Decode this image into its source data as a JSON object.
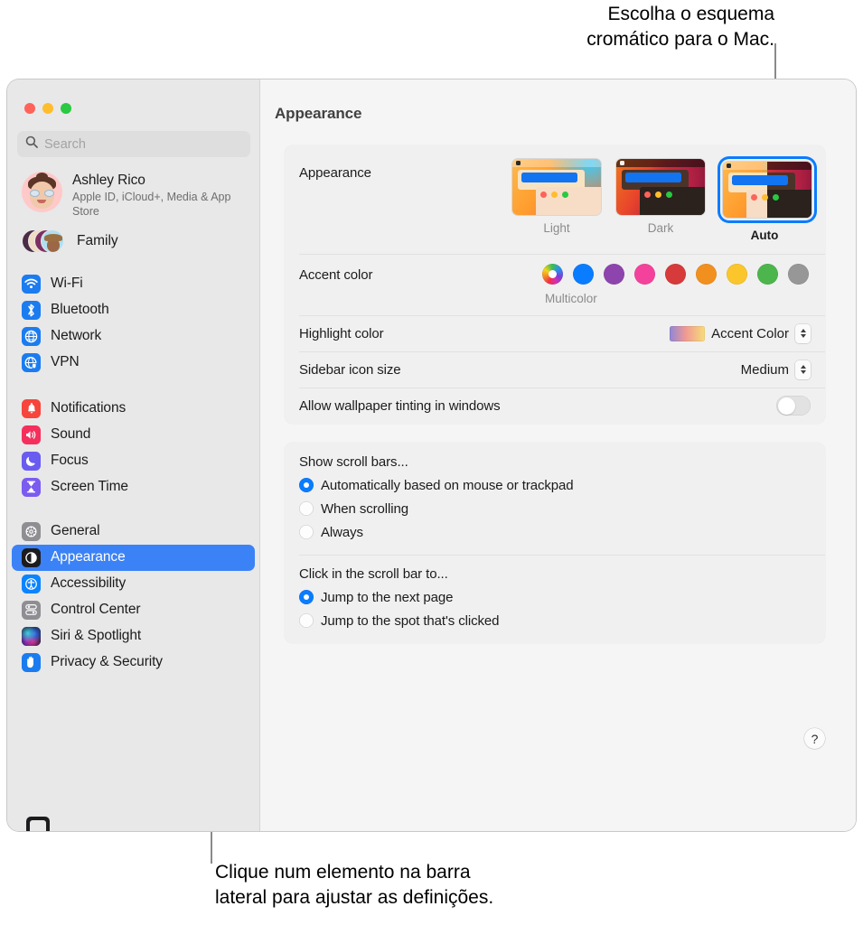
{
  "callouts": {
    "top": "Escolha o esquema\ncromático para o Mac.",
    "bottom": "Clique num elemento na barra\nlateral para ajustar as definições."
  },
  "window": {
    "traffic_lights": [
      "close",
      "minimize",
      "maximize"
    ],
    "pane_title": "Appearance"
  },
  "sidebar": {
    "search": {
      "placeholder": "Search",
      "value": "",
      "icon": "search-icon"
    },
    "profile": {
      "name": "Ashley Rico",
      "subtitle": "Apple ID, iCloud+, Media\n& App Store",
      "avatar": "memoji-avatar"
    },
    "family": {
      "label": "Family",
      "avatar": "family-avatar-stack"
    },
    "groups": [
      {
        "items": [
          {
            "label": "Wi-Fi",
            "icon": "wifi-icon",
            "color": "#1b7cf0",
            "selected": false
          },
          {
            "label": "Bluetooth",
            "icon": "bluetooth-icon",
            "color": "#1b7cf0",
            "selected": false
          },
          {
            "label": "Network",
            "icon": "globe-icon",
            "color": "#1b7cf0",
            "selected": false
          },
          {
            "label": "VPN",
            "icon": "vpn-globe-icon",
            "color": "#1b7cf0",
            "selected": false
          }
        ]
      },
      {
        "items": [
          {
            "label": "Notifications",
            "icon": "bell-icon",
            "color": "#f6453c",
            "selected": false
          },
          {
            "label": "Sound",
            "icon": "speaker-icon",
            "color": "#f52f5c",
            "selected": false
          },
          {
            "label": "Focus",
            "icon": "moon-icon",
            "color": "#6a5cf0",
            "selected": false
          },
          {
            "label": "Screen Time",
            "icon": "hourglass-icon",
            "color": "#7a5cf0",
            "selected": false
          }
        ]
      },
      {
        "items": [
          {
            "label": "General",
            "icon": "gear-icon",
            "color": "#8e8e93",
            "selected": false
          },
          {
            "label": "Appearance",
            "icon": "appearance-contrast-icon",
            "color": "#1c1c1e",
            "selected": true
          },
          {
            "label": "Accessibility",
            "icon": "accessibility-icon",
            "color": "#0a84ff",
            "selected": false
          },
          {
            "label": "Control Center",
            "icon": "control-center-icon",
            "color": "#8e8e93",
            "selected": false
          },
          {
            "label": "Siri & Spotlight",
            "icon": "siri-icon",
            "color": "#2b2b4a",
            "selected": false
          },
          {
            "label": "Privacy & Security",
            "icon": "hand-icon",
            "color": "#1b7cf0",
            "selected": false
          }
        ]
      }
    ]
  },
  "main": {
    "appearance": {
      "label": "Appearance",
      "options": [
        {
          "caption": "Light",
          "selected": false
        },
        {
          "caption": "Dark",
          "selected": false
        },
        {
          "caption": "Auto",
          "selected": true
        }
      ],
      "selection_color": "#0a7cff"
    },
    "accent_color": {
      "label": "Accent color",
      "caption": "Multicolor",
      "swatches": [
        {
          "name": "multicolor",
          "color": "multicolor",
          "selected": true
        },
        {
          "name": "blue",
          "color": "#0a7cff",
          "selected": false
        },
        {
          "name": "purple",
          "color": "#8e44ad",
          "selected": false
        },
        {
          "name": "pink",
          "color": "#f4429c",
          "selected": false
        },
        {
          "name": "red",
          "color": "#d63a3a",
          "selected": false
        },
        {
          "name": "orange",
          "color": "#f2901f",
          "selected": false
        },
        {
          "name": "yellow",
          "color": "#fbc62b",
          "selected": false
        },
        {
          "name": "green",
          "color": "#4cb54c",
          "selected": false
        },
        {
          "name": "graphite",
          "color": "#979797",
          "selected": false
        }
      ]
    },
    "highlight_color": {
      "label": "Highlight color",
      "value": "Accent Color"
    },
    "sidebar_icon_size": {
      "label": "Sidebar icon size",
      "value": "Medium"
    },
    "wallpaper_tinting": {
      "label": "Allow wallpaper tinting in windows",
      "enabled": false
    },
    "show_scroll_bars": {
      "title": "Show scroll bars...",
      "options": [
        {
          "label": "Automatically based on mouse or trackpad",
          "selected": true
        },
        {
          "label": "When scrolling",
          "selected": false
        },
        {
          "label": "Always",
          "selected": false
        }
      ]
    },
    "click_scroll_bar": {
      "title": "Click in the scroll bar to...",
      "options": [
        {
          "label": "Jump to the next page",
          "selected": true
        },
        {
          "label": "Jump to the spot that's clicked",
          "selected": false
        }
      ]
    },
    "help_label": "?"
  }
}
